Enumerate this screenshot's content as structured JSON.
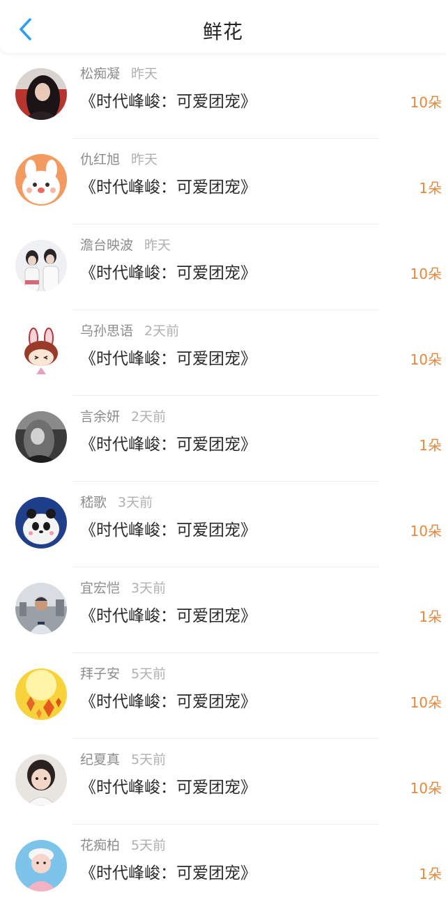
{
  "header": {
    "title": "鲜花",
    "back_icon": "chevron-left-icon",
    "accent": "#2a9df4"
  },
  "colors": {
    "count": "#e8873a"
  },
  "items": [
    {
      "name": "松痴凝",
      "time": "昨天",
      "book": "《时代峰峻：可爱团宠》",
      "count": "10朵",
      "avatar": "avatar-woman-dark-hair"
    },
    {
      "name": "仇红旭",
      "time": "昨天",
      "book": "《时代峰峻：可爱团宠》",
      "count": "1朵",
      "avatar": "avatar-cartoon-bunny-orange"
    },
    {
      "name": "澹台映波",
      "time": "昨天",
      "book": "《时代峰峻：可爱团宠》",
      "count": "10朵",
      "avatar": "avatar-two-girls"
    },
    {
      "name": "乌孙思语",
      "time": "2天前",
      "book": "《时代峰峻：可爱团宠》",
      "count": "10朵",
      "avatar": "avatar-cartoon-rabbit"
    },
    {
      "name": "言余妍",
      "time": "2天前",
      "book": "《时代峰峻：可爱团宠》",
      "count": "1朵",
      "avatar": "avatar-woman-bw"
    },
    {
      "name": "嵇歌",
      "time": "3天前",
      "book": "《时代峰峻：可爱团宠》",
      "count": "10朵",
      "avatar": "avatar-panda-cup"
    },
    {
      "name": "宜宏恺",
      "time": "3天前",
      "book": "《时代峰峻：可爱团宠》",
      "count": "1朵",
      "avatar": "avatar-man-city"
    },
    {
      "name": "拜子安",
      "time": "5天前",
      "book": "《时代峰峻：可爱团宠》",
      "count": "10朵",
      "avatar": "avatar-autumn-leaves"
    },
    {
      "name": "纪夏真",
      "time": "5天前",
      "book": "《时代峰峻：可爱团宠》",
      "count": "10朵",
      "avatar": "avatar-little-girl"
    },
    {
      "name": "花痴柏",
      "time": "5天前",
      "book": "《时代峰峻：可爱团宠》",
      "count": "1朵",
      "avatar": "avatar-baby-pink"
    }
  ]
}
